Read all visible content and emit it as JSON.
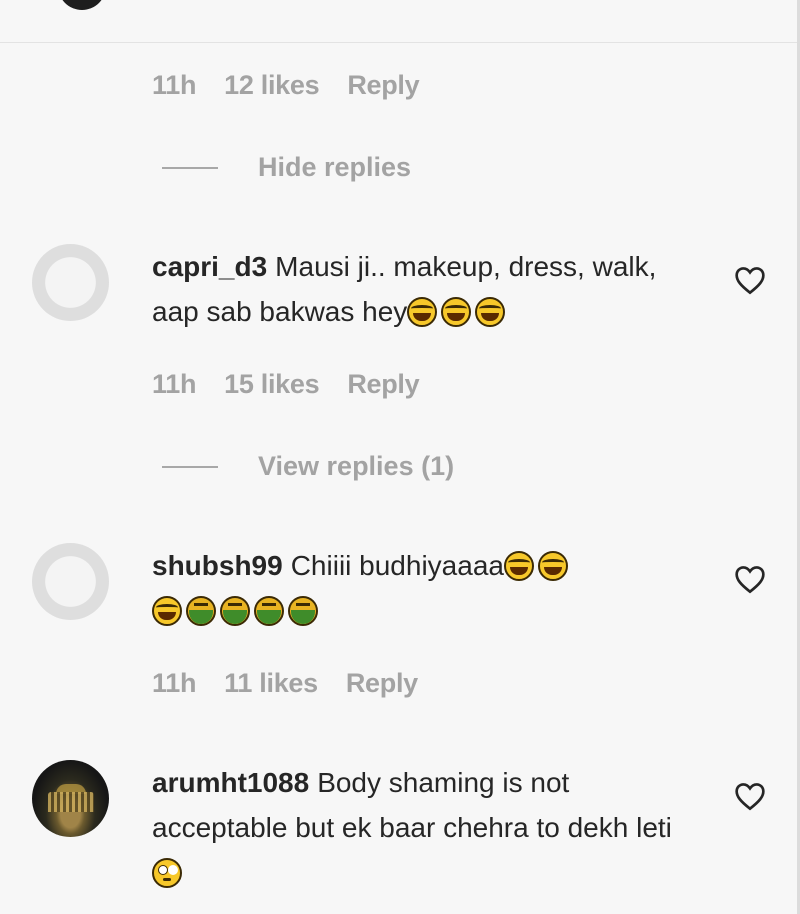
{
  "first_meta": {
    "time": "11h",
    "likes": "12 likes",
    "reply": "Reply"
  },
  "hide_replies": "Hide replies",
  "comments": [
    {
      "username": "capri_d3",
      "text": "Mausi ji.. makeup, dress, walk, aap sab bakwas hey",
      "emojis": [
        "face-with-tears-of-joy",
        "face-with-tears-of-joy",
        "face-with-tears-of-joy"
      ],
      "time": "11h",
      "likes": "15 likes",
      "reply": "Reply",
      "view_replies": "View replies (1)"
    },
    {
      "username": "shubsh99",
      "text": "Chiiii budhiyaaaa",
      "emojis": [
        "face-with-tears-of-joy",
        "face-with-tears-of-joy",
        "face-with-tears-of-joy",
        "nauseated-face",
        "nauseated-face",
        "nauseated-face",
        "nauseated-face"
      ],
      "time": "11h",
      "likes": "11 likes",
      "reply": "Reply"
    },
    {
      "username": "arumht1088",
      "text": "Body shaming is not acceptable but ek baar chehra to dekh leti",
      "emojis": [
        "face-with-rolling-eyes"
      ]
    }
  ],
  "icons": {
    "like": "heart-outline-icon"
  },
  "colors": {
    "background": "#f7f7f7",
    "text": "#262626",
    "muted": "#a3a3a3"
  }
}
